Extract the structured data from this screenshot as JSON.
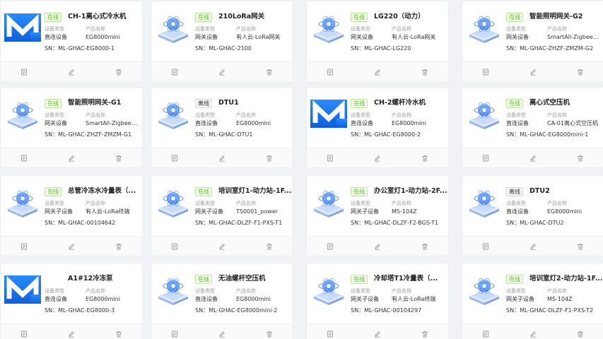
{
  "labels": {
    "device_type": "设备类型",
    "product_name": "产品名称",
    "sn_prefix": "SN："
  },
  "colors": {
    "online": "#52c41a",
    "brand": "#1677ff",
    "card_bg": "#ffffff",
    "page_bg": "#f0f2f5"
  },
  "icons": {
    "view": "view-icon",
    "edit": "edit-icon",
    "delete": "delete-icon"
  },
  "devices": [
    {
      "status": "在线",
      "status_kind": "online",
      "thumb": "logo",
      "name": "CH-1离心式冷水机",
      "type": "直连设备",
      "product": "EG8000mini",
      "sn": "ML-GHAC-EG8000-1"
    },
    {
      "status": "在线",
      "status_kind": "online",
      "thumb": "gateway",
      "name": "210LoRa网关",
      "type": "网关设备",
      "product": "有人云-LoRa网关",
      "sn": "ML-GHAC-2100"
    },
    {
      "status": "在线",
      "status_kind": "online",
      "thumb": "gateway",
      "name": "LG220（动力）",
      "type": "网关设备",
      "product": "有人云-LoRa网关",
      "sn": "ML-GHAC-LG220"
    },
    {
      "status": "在线",
      "status_kind": "online",
      "thumb": "gateway",
      "name": "智能照明网关-G2",
      "type": "网关设备",
      "product": "SmartAll-Zigbee网关",
      "sn": "ML-GHAC-ZHZF-ZMZM-G2"
    },
    {
      "status": "在线",
      "status_kind": "online",
      "thumb": "gateway",
      "name": "智能照明网关-G1",
      "type": "网关设备",
      "product": "SmartAll-Zigbee网关",
      "sn": "ML-GHAC-ZHZF-ZMZM-G1"
    },
    {
      "status": "离线",
      "status_kind": "offline",
      "thumb": "gateway",
      "name": "DTU1",
      "type": "直连设备",
      "product": "EG8000mini",
      "sn": "ML-GHAC-DTU1"
    },
    {
      "status": "在线",
      "status_kind": "online",
      "thumb": "logo",
      "name": "CH-2螺杆冷水机",
      "type": "直连设备",
      "product": "EG8000mini",
      "sn": "ML-GHAC-EG8000-2"
    },
    {
      "status": "在线",
      "status_kind": "online",
      "thumb": "gateway",
      "name": "离心式空压机",
      "type": "直连设备",
      "product": "CA-01离心式空压机",
      "sn": "ML-GHAC-EG8000mini-1"
    },
    {
      "status": "在线",
      "status_kind": "online",
      "thumb": "gateway",
      "name": "总管冷冻水冷量表（...",
      "type": "网关子设备",
      "product": "有人云-LoRa终端",
      "sn": "ML-GHAC-00104642"
    },
    {
      "status": "在线",
      "status_kind": "online",
      "thumb": "gateway",
      "name": "培训室灯1-动力站-1F...",
      "type": "网关子设备",
      "product": "TS0001_power",
      "sn": "ML-GHAC-DLZF-F1-PXS-T1"
    },
    {
      "status": "在线",
      "status_kind": "online",
      "thumb": "gateway",
      "name": "办公室灯1-动力站-2F...",
      "type": "网关子设备",
      "product": "MS-104Z",
      "sn": "ML-GHAC-DLZF-F2-BGS-T1"
    },
    {
      "status": "离线",
      "status_kind": "offline",
      "thumb": "gateway",
      "name": "DTU2",
      "type": "直连设备",
      "product": "EG8000mini",
      "sn": "ML-GHAC-DTU2"
    },
    {
      "status": "",
      "status_kind": "none",
      "thumb": "logo",
      "name": "A1#12冷冻泵",
      "type": "直连设备",
      "product": "EG8000mini",
      "sn": "ML-GHAC-EG8000-3"
    },
    {
      "status": "在线",
      "status_kind": "online",
      "thumb": "gateway",
      "name": "无油螺杆空压机",
      "type": "直连设备",
      "product": "EG8000mini",
      "sn": "ML-GHAC-EG8000mini-2"
    },
    {
      "status": "在线",
      "status_kind": "online",
      "thumb": "gateway",
      "name": "冷却塔T1冷量表（...",
      "type": "网关子设备",
      "product": "有人云-LoRa终端",
      "sn": "ML-GHAC-00104297"
    },
    {
      "status": "在线",
      "status_kind": "online",
      "thumb": "gateway",
      "name": "培训室灯2-动力站-1F...",
      "type": "网关子设备",
      "product": "MS-104Z",
      "sn": "ML-GHAC-DLZF-F1-PXS-T2"
    }
  ]
}
